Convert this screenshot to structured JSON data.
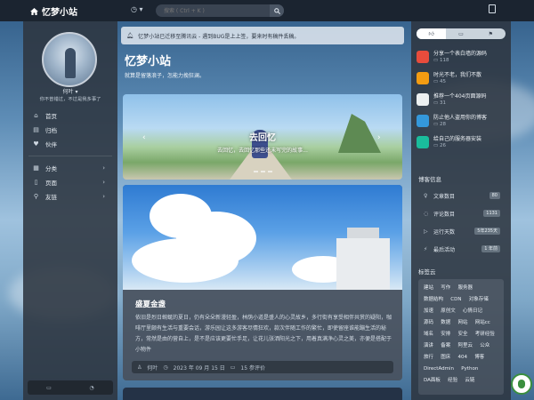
{
  "header": {
    "title": "忆梦小站",
    "search_placeholder": "搜索 ( Ctrl + K )"
  },
  "sidebar": {
    "username": "何叶",
    "tagline": "你不曾错过，不过是我多事了",
    "items": [
      {
        "label": "首页",
        "icon": "home-icon"
      },
      {
        "label": "归档",
        "icon": "archive-icon"
      },
      {
        "label": "伙伴",
        "icon": "heart-icon"
      },
      {
        "label": "分类",
        "icon": "category-icon"
      },
      {
        "label": "页面",
        "icon": "page-icon"
      },
      {
        "label": "友链",
        "icon": "link-icon"
      }
    ]
  },
  "notice": {
    "text": "忆梦小站已迁移至腾讯云 - 遇到BUG是上上签，要来时有稿件丢稿。"
  },
  "hero": {
    "title": "忆梦小站",
    "subtitle": "就算是留落浪子，怎能力挽狂澜。"
  },
  "banner": {
    "title": "去回忆",
    "subtitle": "去回忆，去回忆那些还未写完的故事..."
  },
  "post": {
    "title": "盛夏金盏",
    "body": "依旧是烈日蜿蜒的夏日，仍有朵朵新漫轻盈，林荫小道是盛人的心灵故乡，多行街有享受相伴共赏的疑阳，咖啡厅里颇有生活与重要会话，游乐园让这多游客尽情狂欢，款次伴随工作的繁忙，即使留座谁能蹦生活的秘方，常然是由的营自上，是不是应该更要忙手足，让花儿张洒阳光之下，用着真满净心灵之美，亦便是搭配于小物件",
    "author": "何叶",
    "date": "2023 年 09 月 15 日",
    "read_time": "15 参评价"
  },
  "right": {
    "tabs": [
      "热门",
      "评论",
      "标签"
    ],
    "hot": [
      {
        "title": "分享一个表白墙的源码",
        "count": "118",
        "color": "#e74c3c"
      },
      {
        "title": "时光不老，我们不散",
        "count": "45",
        "color": "#f39c12"
      },
      {
        "title": "推荐一个404页面源码",
        "count": "31",
        "color": "#ecf0f1"
      },
      {
        "title": "防止他人盗用你的博客",
        "count": "28",
        "color": "#3498db"
      },
      {
        "title": "给自己的服务器安装",
        "count": "26",
        "color": "#1abc9c"
      }
    ],
    "info_title": "博客信息",
    "stats": [
      {
        "label": "文章数目",
        "value": "80",
        "icon": "document-icon"
      },
      {
        "label": "评论数目",
        "value": "1131",
        "icon": "comment-icon"
      },
      {
        "label": "运行天数",
        "value": "5年235天",
        "icon": "calendar-icon"
      },
      {
        "label": "最后活动",
        "value": "1 年前",
        "icon": "activity-icon"
      }
    ],
    "tags_title": "标签云",
    "tags": [
      "建站",
      "写作",
      "服务器",
      "数据结构",
      "CDN",
      "对象存储",
      "加速",
      "原创文",
      "心情日记",
      "源码",
      "数据",
      "网站",
      "网站cc",
      "域名",
      "安排",
      "安全",
      "考研经验",
      "演讲",
      "备案",
      "阿里云",
      "公众",
      "旅行",
      "图床",
      "404",
      "博客",
      "DirectAdmin",
      "Python",
      "DA面板",
      "经验",
      "云链"
    ]
  }
}
